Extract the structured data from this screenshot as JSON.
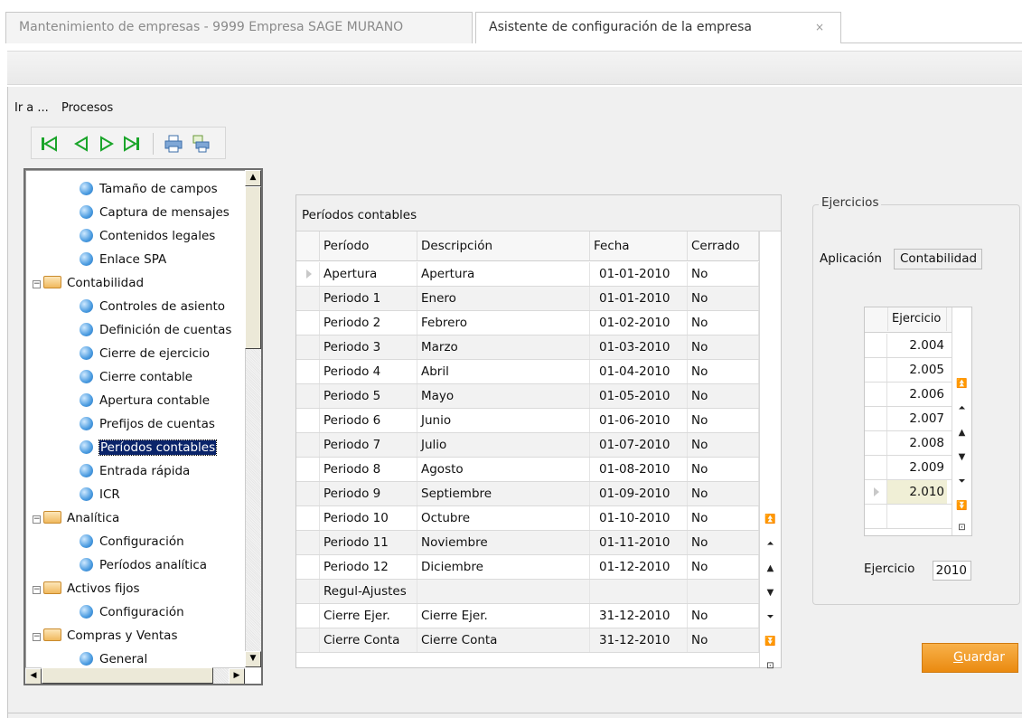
{
  "tabs": [
    {
      "label": "Mantenimiento de empresas - 9999 Empresa SAGE MURANO"
    },
    {
      "label": "Asistente de configuración de la empresa",
      "close": "×"
    }
  ],
  "menu": {
    "ir_a": "Ir a ...",
    "procesos": "Procesos"
  },
  "navbar": {
    "buttons": [
      "first-record-icon",
      "previous-record-icon",
      "next-record-icon",
      "last-record-icon",
      "print-icon",
      "print-preview-icon"
    ],
    "accent": "#1aa52a"
  },
  "tree": {
    "items": [
      {
        "label": "Tamaño de campos",
        "level": 2,
        "type": "leaf"
      },
      {
        "label": "Captura de mensajes",
        "level": 2,
        "type": "leaf"
      },
      {
        "label": "Contenidos legales",
        "level": 2,
        "type": "leaf"
      },
      {
        "label": "Enlace SPA",
        "level": 2,
        "type": "leaf"
      },
      {
        "label": "Contabilidad",
        "level": 1,
        "type": "folder",
        "expander": "−"
      },
      {
        "label": "Controles de asiento",
        "level": 2,
        "type": "leaf"
      },
      {
        "label": "Definición de cuentas",
        "level": 2,
        "type": "leaf"
      },
      {
        "label": "Cierre de ejercicio",
        "level": 2,
        "type": "leaf"
      },
      {
        "label": "Cierre contable",
        "level": 2,
        "type": "leaf"
      },
      {
        "label": "Apertura contable",
        "level": 2,
        "type": "leaf"
      },
      {
        "label": "Prefijos de cuentas",
        "level": 2,
        "type": "leaf"
      },
      {
        "label": "Períodos contables",
        "level": 2,
        "type": "leaf",
        "selected": true
      },
      {
        "label": "Entrada rápida",
        "level": 2,
        "type": "leaf"
      },
      {
        "label": "ICR",
        "level": 2,
        "type": "leaf"
      },
      {
        "label": "Analítica",
        "level": 1,
        "type": "folder",
        "expander": "−"
      },
      {
        "label": "Configuración",
        "level": 2,
        "type": "leaf"
      },
      {
        "label": "Períodos analítica",
        "level": 2,
        "type": "leaf"
      },
      {
        "label": "Activos fijos",
        "level": 1,
        "type": "folder",
        "expander": "−"
      },
      {
        "label": "Configuración",
        "level": 2,
        "type": "leaf"
      },
      {
        "label": "Compras y Ventas",
        "level": 1,
        "type": "folder",
        "expander": "−"
      },
      {
        "label": "General",
        "level": 2,
        "type": "leaf"
      }
    ]
  },
  "periodos": {
    "caption": "Períodos contables",
    "columns": [
      "Período",
      "Descripción",
      "Fecha",
      "Cerrado"
    ],
    "rows": [
      [
        "Apertura",
        "Apertura",
        "01-01-2010",
        "No"
      ],
      [
        "Periodo 1",
        "Enero",
        "01-01-2010",
        "No"
      ],
      [
        "Periodo 2",
        "Febrero",
        "01-02-2010",
        "No"
      ],
      [
        "Periodo 3",
        "Marzo",
        "01-03-2010",
        "No"
      ],
      [
        "Periodo 4",
        "Abril",
        "01-04-2010",
        "No"
      ],
      [
        "Periodo 5",
        "Mayo",
        "01-05-2010",
        "No"
      ],
      [
        "Periodo 6",
        "Junio",
        "01-06-2010",
        "No"
      ],
      [
        "Periodo 7",
        "Julio",
        "01-07-2010",
        "No"
      ],
      [
        "Periodo 8",
        "Agosto",
        "01-08-2010",
        "No"
      ],
      [
        "Periodo 9",
        "Septiembre",
        "01-09-2010",
        "No"
      ],
      [
        "Periodo 10",
        "Octubre",
        "01-10-2010",
        "No"
      ],
      [
        "Periodo 11",
        "Noviembre",
        "01-11-2010",
        "No"
      ],
      [
        "Periodo 12",
        "Diciembre",
        "01-12-2010",
        "No"
      ],
      [
        "Regul-Ajustes",
        "",
        "",
        ""
      ],
      [
        "Cierre Ejer.",
        "Cierre Ejer.",
        "31-12-2010",
        "No"
      ],
      [
        "Cierre Conta",
        "Cierre Conta",
        "31-12-2010",
        "No"
      ]
    ],
    "scroll_buttons": [
      "scroll-top-icon",
      "page-up-icon",
      "scroll-up-icon",
      "scroll-down-icon",
      "page-down-icon",
      "scroll-bottom-icon",
      "grid-export-icon"
    ]
  },
  "ejercicios": {
    "group_title": "Ejercicios",
    "aplicacion_label": "Aplicación",
    "aplicacion_value": "Contabilidad",
    "grid_header": "Ejercicio",
    "grid_values": [
      "2.004",
      "2.005",
      "2.006",
      "2.007",
      "2.008",
      "2.009",
      "2.010"
    ],
    "current_index": 6,
    "ejercicio_label": "Ejercicio",
    "ejercicio_value": "2010"
  },
  "guardar": {
    "first_letter": "G",
    "rest": "uardar",
    "color": "#ef9a1c"
  }
}
